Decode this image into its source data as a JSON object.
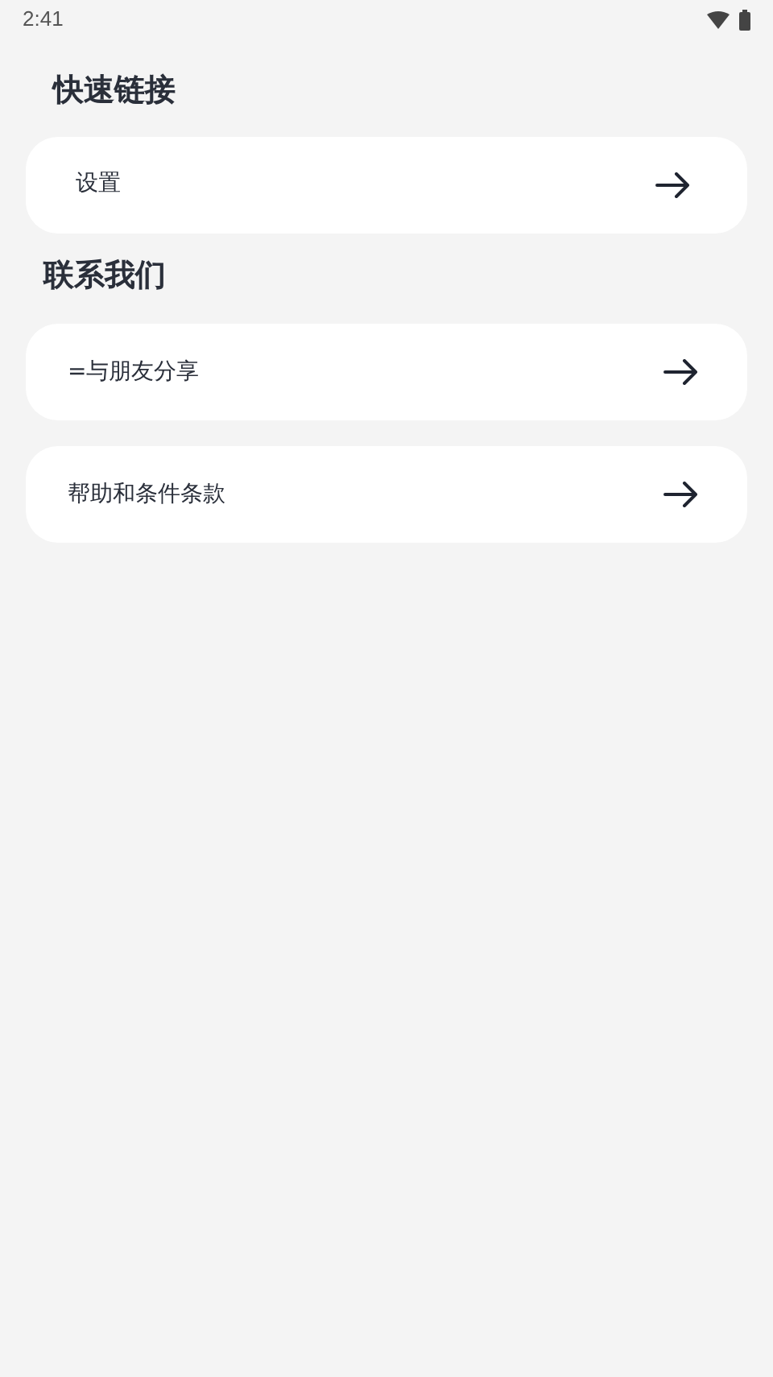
{
  "status_bar": {
    "time": "2:41"
  },
  "sections": [
    {
      "title": "快速链接",
      "items": [
        {
          "label": "设置"
        }
      ]
    },
    {
      "title": "联系我们",
      "items": [
        {
          "label": "=与朋友分享"
        },
        {
          "label": "帮助和条件条款"
        }
      ]
    }
  ]
}
